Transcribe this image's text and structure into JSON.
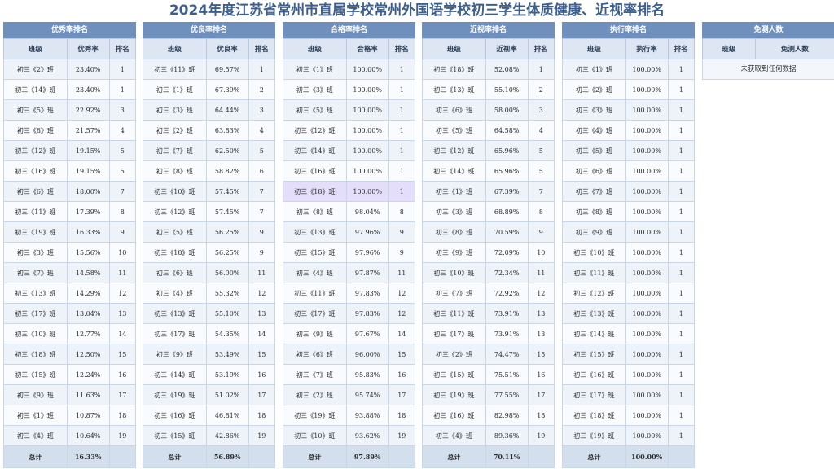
{
  "title": "2024年度江苏省常州市直属学校常州外国语学校初三学生体质健康、近视率排名",
  "panels": [
    {
      "title": "优秀率排名",
      "headers": [
        "班级",
        "优秀率",
        "排名"
      ],
      "rows": [
        [
          "初三《2》班",
          "23.40%",
          "1"
        ],
        [
          "初三《14》班",
          "23.40%",
          "1"
        ],
        [
          "初三《5》班",
          "22.92%",
          "3"
        ],
        [
          "初三《8》班",
          "21.57%",
          "4"
        ],
        [
          "初三《12》班",
          "19.15%",
          "5"
        ],
        [
          "初三《16》班",
          "19.15%",
          "5"
        ],
        [
          "初三《6》班",
          "18.00%",
          "7"
        ],
        [
          "初三《11》班",
          "17.39%",
          "8"
        ],
        [
          "初三《19》班",
          "16.33%",
          "9"
        ],
        [
          "初三《3》班",
          "15.56%",
          "10"
        ],
        [
          "初三《7》班",
          "14.58%",
          "11"
        ],
        [
          "初三《13》班",
          "14.29%",
          "12"
        ],
        [
          "初三《17》班",
          "13.04%",
          "13"
        ],
        [
          "初三《10》班",
          "12.77%",
          "14"
        ],
        [
          "初三《18》班",
          "12.50%",
          "15"
        ],
        [
          "初三《15》班",
          "12.24%",
          "16"
        ],
        [
          "初三《9》班",
          "11.63%",
          "17"
        ],
        [
          "初三《1》班",
          "10.87%",
          "18"
        ],
        [
          "初三《4》班",
          "10.64%",
          "19"
        ]
      ],
      "total": [
        "总计",
        "16.33%",
        ""
      ]
    },
    {
      "title": "优良率排名",
      "headers": [
        "班级",
        "优良率",
        "排名"
      ],
      "rows": [
        [
          "初三《11》班",
          "69.57%",
          "1"
        ],
        [
          "初三《1》班",
          "67.39%",
          "2"
        ],
        [
          "初三《3》班",
          "64.44%",
          "3"
        ],
        [
          "初三《2》班",
          "63.83%",
          "4"
        ],
        [
          "初三《7》班",
          "62.50%",
          "5"
        ],
        [
          "初三《8》班",
          "58.82%",
          "6"
        ],
        [
          "初三《10》班",
          "57.45%",
          "7"
        ],
        [
          "初三《12》班",
          "57.45%",
          "7"
        ],
        [
          "初三《5》班",
          "56.25%",
          "9"
        ],
        [
          "初三《18》班",
          "56.25%",
          "9"
        ],
        [
          "初三《6》班",
          "56.00%",
          "11"
        ],
        [
          "初三《4》班",
          "55.32%",
          "12"
        ],
        [
          "初三《13》班",
          "55.10%",
          "13"
        ],
        [
          "初三《17》班",
          "54.35%",
          "14"
        ],
        [
          "初三《9》班",
          "53.49%",
          "15"
        ],
        [
          "初三《14》班",
          "53.19%",
          "16"
        ],
        [
          "初三《19》班",
          "51.02%",
          "17"
        ],
        [
          "初三《16》班",
          "46.81%",
          "18"
        ],
        [
          "初三《15》班",
          "42.86%",
          "19"
        ]
      ],
      "total": [
        "总计",
        "56.89%",
        ""
      ]
    },
    {
      "title": "合格率排名",
      "headers": [
        "班级",
        "合格率",
        "排名"
      ],
      "rows": [
        [
          "初三《1》班",
          "100.00%",
          "1"
        ],
        [
          "初三《3》班",
          "100.00%",
          "1"
        ],
        [
          "初三《5》班",
          "100.00%",
          "1"
        ],
        [
          "初三《12》班",
          "100.00%",
          "1"
        ],
        [
          "初三《14》班",
          "100.00%",
          "1"
        ],
        [
          "初三《16》班",
          "100.00%",
          "1"
        ],
        [
          "初三《18》班",
          "100.00%",
          "1"
        ],
        [
          "初三《8》班",
          "98.04%",
          "8"
        ],
        [
          "初三《13》班",
          "97.96%",
          "9"
        ],
        [
          "初三《15》班",
          "97.96%",
          "9"
        ],
        [
          "初三《4》班",
          "97.87%",
          "11"
        ],
        [
          "初三《11》班",
          "97.83%",
          "12"
        ],
        [
          "初三《17》班",
          "97.83%",
          "12"
        ],
        [
          "初三《9》班",
          "97.67%",
          "14"
        ],
        [
          "初三《6》班",
          "96.00%",
          "15"
        ],
        [
          "初三《7》班",
          "95.83%",
          "16"
        ],
        [
          "初三《2》班",
          "95.74%",
          "17"
        ],
        [
          "初三《19》班",
          "93.88%",
          "18"
        ],
        [
          "初三《10》班",
          "93.62%",
          "19"
        ]
      ],
      "total": [
        "总计",
        "97.89%",
        ""
      ],
      "highlight_row": 6
    },
    {
      "title": "近视率排名",
      "headers": [
        "班级",
        "近视率",
        "排名"
      ],
      "rows": [
        [
          "初三《18》班",
          "52.08%",
          "1"
        ],
        [
          "初三《13》班",
          "55.10%",
          "2"
        ],
        [
          "初三《6》班",
          "58.00%",
          "3"
        ],
        [
          "初三《5》班",
          "64.58%",
          "4"
        ],
        [
          "初三《12》班",
          "65.96%",
          "5"
        ],
        [
          "初三《14》班",
          "65.96%",
          "5"
        ],
        [
          "初三《1》班",
          "67.39%",
          "7"
        ],
        [
          "初三《3》班",
          "68.89%",
          "8"
        ],
        [
          "初三《8》班",
          "70.59%",
          "9"
        ],
        [
          "初三《9》班",
          "72.09%",
          "10"
        ],
        [
          "初三《10》班",
          "72.34%",
          "11"
        ],
        [
          "初三《7》班",
          "72.92%",
          "12"
        ],
        [
          "初三《11》班",
          "73.91%",
          "13"
        ],
        [
          "初三《17》班",
          "73.91%",
          "13"
        ],
        [
          "初三《2》班",
          "74.47%",
          "15"
        ],
        [
          "初三《15》班",
          "75.51%",
          "16"
        ],
        [
          "初三《19》班",
          "77.55%",
          "17"
        ],
        [
          "初三《16》班",
          "82.98%",
          "18"
        ],
        [
          "初三《4》班",
          "89.36%",
          "19"
        ]
      ],
      "total": [
        "总计",
        "70.11%",
        ""
      ]
    },
    {
      "title": "执行率排名",
      "headers": [
        "班级",
        "执行率",
        "排名"
      ],
      "rows": [
        [
          "初三《1》班",
          "100.00%",
          "1"
        ],
        [
          "初三《2》班",
          "100.00%",
          "1"
        ],
        [
          "初三《3》班",
          "100.00%",
          "1"
        ],
        [
          "初三《4》班",
          "100.00%",
          "1"
        ],
        [
          "初三《5》班",
          "100.00%",
          "1"
        ],
        [
          "初三《6》班",
          "100.00%",
          "1"
        ],
        [
          "初三《7》班",
          "100.00%",
          "1"
        ],
        [
          "初三《8》班",
          "100.00%",
          "1"
        ],
        [
          "初三《9》班",
          "100.00%",
          "1"
        ],
        [
          "初三《10》班",
          "100.00%",
          "1"
        ],
        [
          "初三《11》班",
          "100.00%",
          "1"
        ],
        [
          "初三《12》班",
          "100.00%",
          "1"
        ],
        [
          "初三《13》班",
          "100.00%",
          "1"
        ],
        [
          "初三《14》班",
          "100.00%",
          "1"
        ],
        [
          "初三《15》班",
          "100.00%",
          "1"
        ],
        [
          "初三《16》班",
          "100.00%",
          "1"
        ],
        [
          "初三《17》班",
          "100.00%",
          "1"
        ],
        [
          "初三《18》班",
          "100.00%",
          "1"
        ],
        [
          "初三《19》班",
          "100.00%",
          "1"
        ]
      ],
      "total": [
        "总计",
        "100.00%",
        ""
      ]
    }
  ],
  "exempt": {
    "title": "免测人数",
    "headers": [
      "班级",
      "免测人数"
    ],
    "empty_text": "未获取到任何数据"
  }
}
